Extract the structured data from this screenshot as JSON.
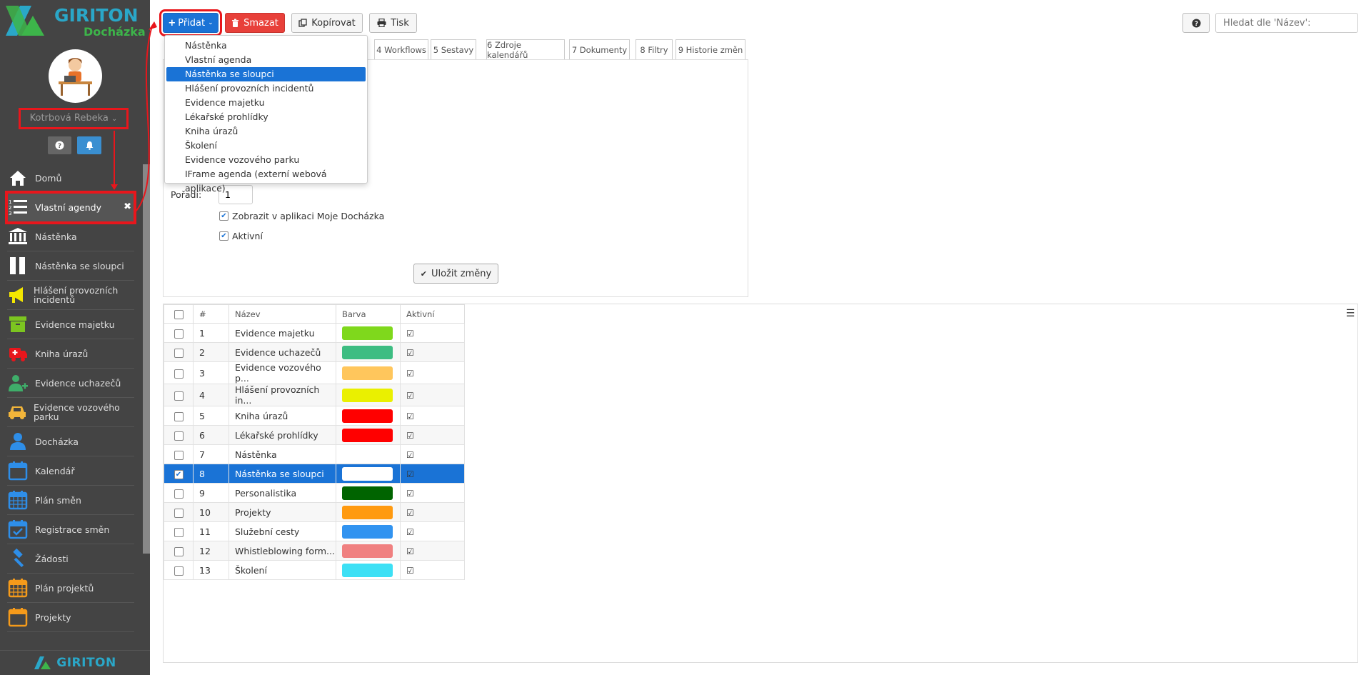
{
  "app": {
    "logo_text": "GIRITON",
    "logo_subtext": "Docházka",
    "footer_logo_text": "GIRITON",
    "brand_blue": "#2aa7c8",
    "brand_green": "#3db54a"
  },
  "user": {
    "name": "Kotrbová Rebeka"
  },
  "nav": [
    {
      "label": "Domů",
      "icon": "home-icon",
      "color": "#ffffff"
    },
    {
      "label": "Vlastní agendy",
      "icon": "numbered-list-icon",
      "color": "#ffffff",
      "active": true
    },
    {
      "label": "Nástěnka",
      "icon": "bank-icon",
      "color": "#ffffff"
    },
    {
      "label": "Nástěnka se sloupci",
      "icon": "columns-icon",
      "color": "#ffffff"
    },
    {
      "label": "Hlášení provozních incidentů",
      "icon": "megaphone-icon",
      "color": "#f3e600"
    },
    {
      "label": "Evidence majetku",
      "icon": "archive-icon",
      "color": "#7cc520"
    },
    {
      "label": "Kniha úrazů",
      "icon": "ambulance-icon",
      "color": "#e8161c"
    },
    {
      "label": "Evidence uchazečů",
      "icon": "user-plus-icon",
      "color": "#3fae6a"
    },
    {
      "label": "Evidence vozového parku",
      "icon": "car-icon",
      "color": "#f2b53a"
    },
    {
      "label": "Docházka",
      "icon": "user-icon",
      "color": "#2e8ee8"
    },
    {
      "label": "Kalendář",
      "icon": "calendar-icon",
      "color": "#2e8ee8"
    },
    {
      "label": "Plán směn",
      "icon": "calendar-grid-icon",
      "color": "#2e8ee8"
    },
    {
      "label": "Registrace směn",
      "icon": "calendar-check-icon",
      "color": "#2e8ee8"
    },
    {
      "label": "Žádosti",
      "icon": "gavel-icon",
      "color": "#2e8ee8"
    },
    {
      "label": "Plán projektů",
      "icon": "calendar-grid-icon",
      "color": "#f59a1a"
    },
    {
      "label": "Projekty",
      "icon": "calendar-icon",
      "color": "#f59a1a"
    }
  ],
  "toolbar": {
    "add_label": "Přidat",
    "delete_label": "Smazat",
    "copy_label": "Kopírovat",
    "print_label": "Tisk",
    "search_placeholder": "Hledat dle 'Název':"
  },
  "tabs": [
    "4 Workflows",
    "5 Sestavy",
    "6 Zdroje kalendářů",
    "7 Dokumenty",
    "8 Filtry",
    "9 Historie změn"
  ],
  "dropdown": [
    {
      "label": "Nástěnka"
    },
    {
      "label": "Vlastní agenda"
    },
    {
      "label": "Nástěnka se sloupci",
      "selected": true
    },
    {
      "label": "Hlášení provozních incidentů"
    },
    {
      "label": "Evidence majetku"
    },
    {
      "label": "Lékařské prohlídky"
    },
    {
      "label": "Kniha úrazů"
    },
    {
      "label": "Školení"
    },
    {
      "label": "Evidence vozového parku"
    },
    {
      "label": "IFrame agenda (externí webová aplikace)"
    }
  ],
  "form": {
    "order_label": "Pořadí:",
    "order_value": "1",
    "show_in_app_label": "Zobrazit v aplikaci Moje Docházka",
    "show_in_app": true,
    "active_label": "Aktivní",
    "active": true,
    "save_label": "Uložit změny"
  },
  "grid": {
    "columns": [
      "#",
      "Název",
      "Barva",
      "Aktivní"
    ],
    "rows": [
      {
        "num": "1",
        "name": "Evidence majetku",
        "color": "#7fd81c",
        "active": true,
        "checked": false
      },
      {
        "num": "2",
        "name": "Evidence uchazečů",
        "color": "#3dbd82",
        "active": true,
        "checked": false
      },
      {
        "num": "3",
        "name": "Evidence vozového p...",
        "color": "#ffc65c",
        "active": true,
        "checked": false
      },
      {
        "num": "4",
        "name": "Hlášení provozních in...",
        "color": "#eaf000",
        "active": true,
        "checked": false
      },
      {
        "num": "5",
        "name": "Kniha úrazů",
        "color": "#ff0000",
        "active": true,
        "checked": false
      },
      {
        "num": "6",
        "name": "Lékařské prohlídky",
        "color": "#ff0000",
        "active": true,
        "checked": false
      },
      {
        "num": "7",
        "name": "Nástěnka",
        "color": "",
        "active": true,
        "checked": false
      },
      {
        "num": "8",
        "name": "Nástěnka se sloupci",
        "color": "#ffffff",
        "active": true,
        "checked": true,
        "selected": true
      },
      {
        "num": "9",
        "name": "Personalistika",
        "color": "#006400",
        "active": true,
        "checked": false
      },
      {
        "num": "10",
        "name": "Projekty",
        "color": "#ff9a10",
        "active": true,
        "checked": false
      },
      {
        "num": "11",
        "name": "Služební cesty",
        "color": "#3193f0",
        "active": true,
        "checked": false
      },
      {
        "num": "12",
        "name": "Whistleblowing form...",
        "color": "#f08080",
        "active": true,
        "checked": false
      },
      {
        "num": "13",
        "name": "Školení",
        "color": "#3de0f5",
        "active": true,
        "checked": false
      }
    ]
  },
  "colors": {
    "primary": "#1a73d6",
    "danger": "#e8403a",
    "highlight": "#e8161c",
    "sidebar": "#444444"
  }
}
